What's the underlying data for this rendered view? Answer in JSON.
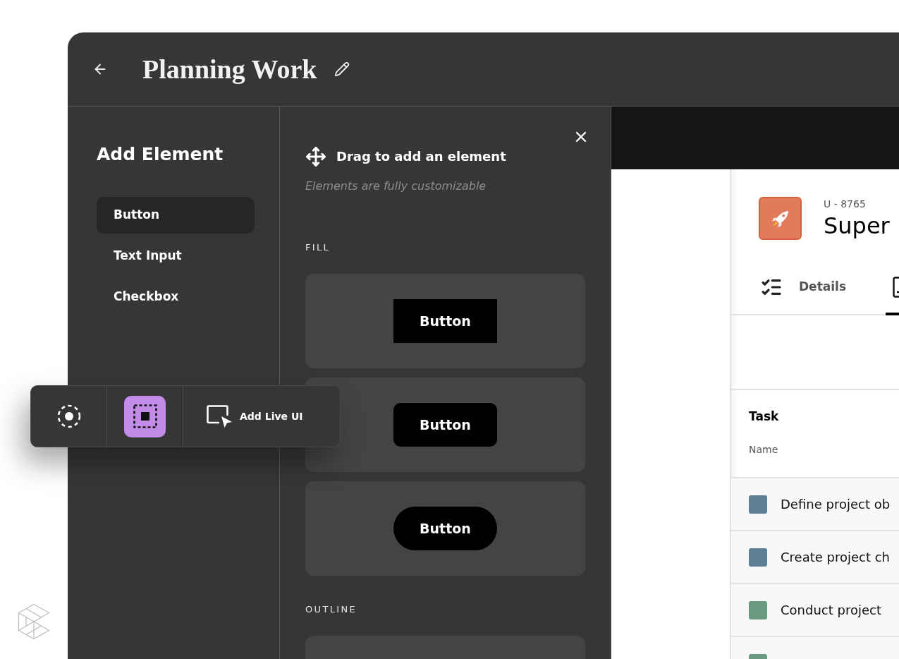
{
  "window": {
    "title": "Planning Work"
  },
  "element_panel": {
    "title": "Add Element",
    "items": [
      {
        "label": "Button",
        "selected": true
      },
      {
        "label": "Text Input",
        "selected": false
      },
      {
        "label": "Checkbox",
        "selected": false
      }
    ]
  },
  "preview_panel": {
    "heading": "Drag to add an element",
    "subtitle": "Elements are fully customizable",
    "sections": [
      {
        "title": "FILL",
        "items": [
          {
            "kind": "square",
            "label": "Button"
          },
          {
            "kind": "rounded",
            "label": "Button"
          },
          {
            "kind": "pill",
            "label": "Button"
          }
        ]
      },
      {
        "title": "OUTLINE",
        "cut_off_card": true
      }
    ]
  },
  "toolbar": {
    "tools": [
      {
        "kind": "target",
        "selected": false
      },
      {
        "kind": "frame",
        "selected": true
      },
      {
        "kind": "live_ui",
        "label": "Add Live UI",
        "selected": false
      }
    ]
  },
  "record": {
    "code": "U - 8765",
    "title": "Super",
    "tabs": [
      {
        "label": "Details",
        "selected": false
      },
      {
        "selected": true
      }
    ],
    "table": {
      "title": "Task",
      "column": "Name",
      "rows": [
        {
          "name": "Define project ob",
          "color": "#5e8095"
        },
        {
          "name": "Create project ch",
          "color": "#5e8095"
        },
        {
          "name": "Conduct project",
          "color": "#6a9b80"
        },
        {
          "color": "#6a9b80"
        }
      ]
    }
  }
}
